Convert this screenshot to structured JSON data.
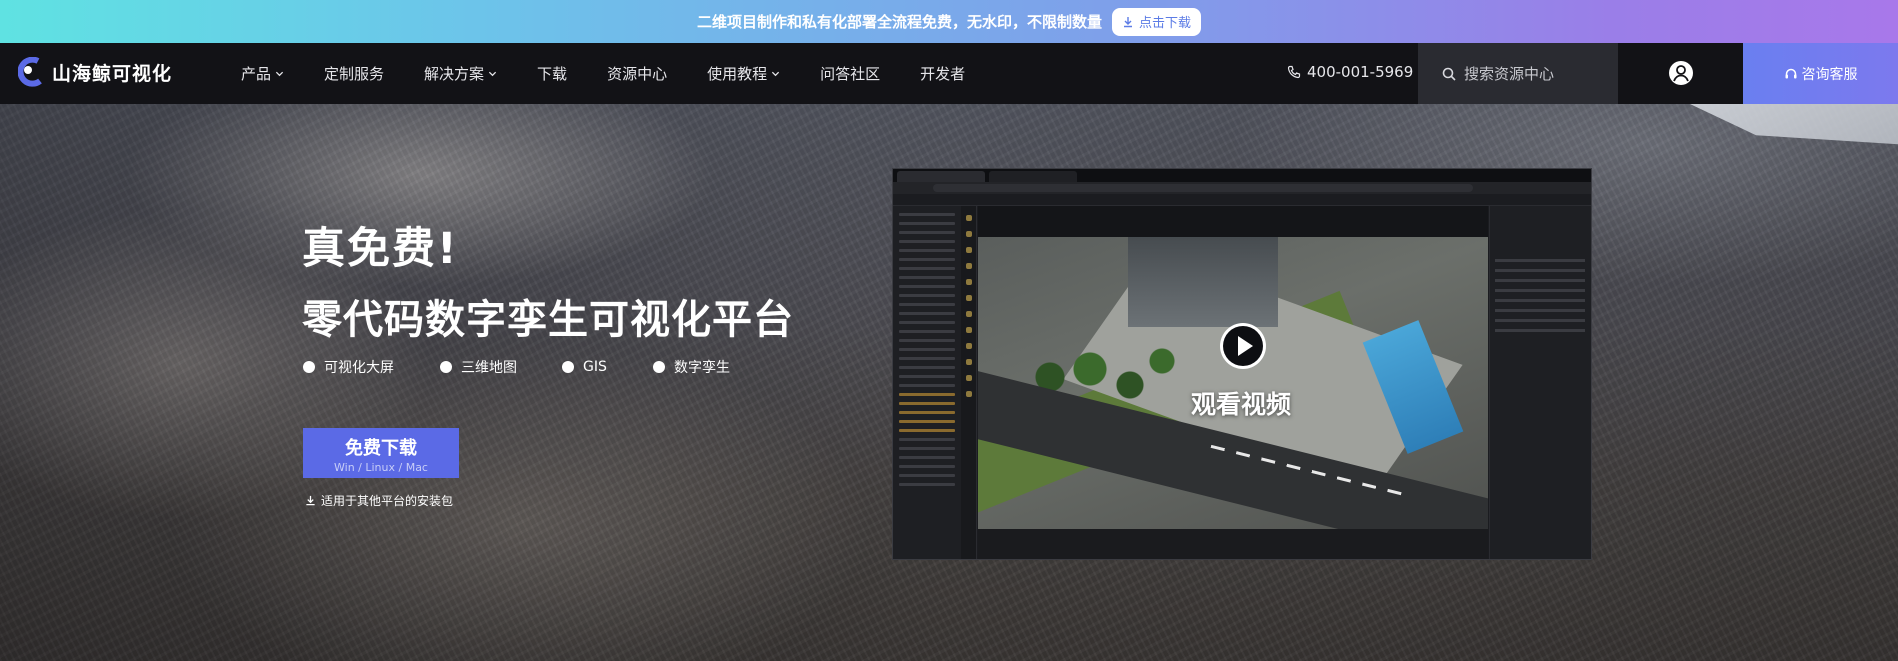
{
  "banner": {
    "text": "二维项目制作和私有化部署全流程免费，无水印，不限制数量",
    "button_label": "点击下载",
    "button_icon": "download-icon"
  },
  "nav": {
    "logo_text": "山海鲸可视化",
    "items": [
      {
        "label": "产品",
        "dropdown": true
      },
      {
        "label": "定制服务",
        "dropdown": false
      },
      {
        "label": "解决方案",
        "dropdown": true
      },
      {
        "label": "下载",
        "dropdown": false
      },
      {
        "label": "资源中心",
        "dropdown": false
      },
      {
        "label": "使用教程",
        "dropdown": true
      },
      {
        "label": "问答社区",
        "dropdown": false
      },
      {
        "label": "开发者",
        "dropdown": false
      }
    ],
    "phone": "400-001-5969",
    "search_placeholder": "搜索资源中心",
    "consult_label": "咨询客服"
  },
  "hero": {
    "title_line1": "真免费!",
    "title_line2": "零代码数字孪生可视化平台",
    "features": [
      "可视化大屏",
      "三维地图",
      "GIS",
      "数字孪生"
    ],
    "download_label": "免费下载",
    "download_platforms": "Win / Linux / Mac",
    "other_packages_label": "适用于其他平台的安装包",
    "video_label": "观看视频"
  },
  "colors": {
    "nav_bg": "#121216",
    "accent": "#5b6ae6",
    "consult_bg": "#6a7ff0"
  }
}
